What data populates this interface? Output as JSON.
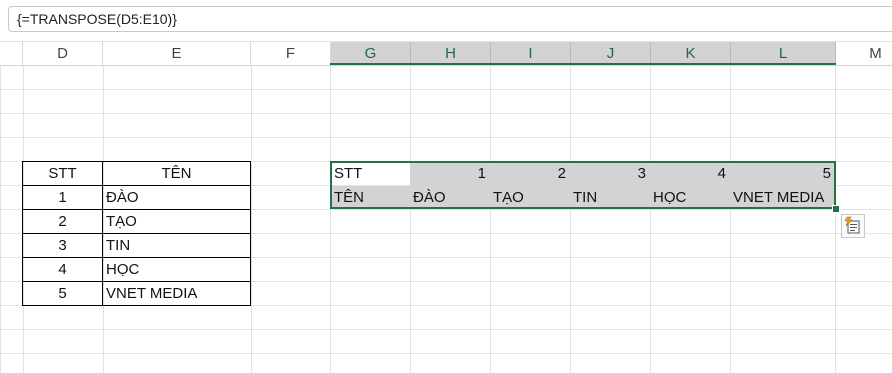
{
  "formula_bar": {
    "formula": "{=TRANSPOSE(D5:E10)}"
  },
  "columns": [
    "D",
    "E",
    "F",
    "G",
    "H",
    "I",
    "J",
    "K",
    "L",
    "M"
  ],
  "source_table": {
    "headers": [
      "STT",
      "TÊN"
    ],
    "rows": [
      [
        "1",
        "ĐÀO"
      ],
      [
        "2",
        "TẠO"
      ],
      [
        "3",
        "TIN"
      ],
      [
        "4",
        "HỌC"
      ],
      [
        "5",
        "VNET MEDIA"
      ]
    ]
  },
  "transposed": {
    "row1": [
      "STT",
      "1",
      "2",
      "3",
      "4",
      "5"
    ],
    "row2": [
      "TÊN",
      "ĐÀO",
      "TẠO",
      "TIN",
      "HỌC",
      "VNET MEDIA"
    ]
  },
  "colors": {
    "selection": "#217346",
    "shade": "#d3d3d3"
  },
  "icons": [
    "paste-options-icon"
  ]
}
